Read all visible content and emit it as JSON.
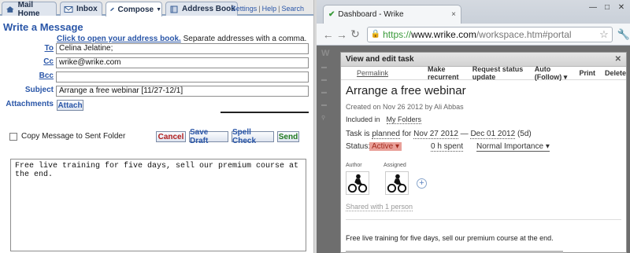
{
  "mail": {
    "tabs": [
      {
        "label": "Mail Home",
        "icon": "house-icon"
      },
      {
        "label": "Inbox",
        "icon": "envelope-icon"
      },
      {
        "label": "Compose",
        "icon": "pen-icon"
      },
      {
        "label": "Address Book",
        "icon": "book-icon"
      }
    ],
    "top_links": {
      "settings": "Settings",
      "help": "Help",
      "search": "Search"
    },
    "title": "Write a Message",
    "address_hint_link": "Click to open your address book.",
    "address_hint_text": " Separate addresses with a comma.",
    "fields": {
      "to_label": "To",
      "to_value": "Celina Jelatine;",
      "cc_label": "Cc",
      "cc_value": "wrike@wrike.com",
      "bcc_label": "Bcc",
      "bcc_value": "",
      "subject_label": "Subject",
      "subject_value": "Arrange a free webinar [11/27-12/1]",
      "attachments_label": "Attachments"
    },
    "attach_button": "Attach",
    "copy_label": "Copy Message to Sent Folder",
    "buttons": {
      "cancel": "Cancel",
      "save_draft": "Save Draft",
      "spell_check": "Spell Check",
      "send": "Send"
    },
    "body": "Free live training for five days, sell our premium course at the end."
  },
  "browser": {
    "tab_title": "Dashboard - Wrike",
    "url_scheme": "https://",
    "url_host": "www.wrike.com",
    "url_path": "/workspace.htm#portal",
    "modal": {
      "title": "View and edit task",
      "toolbar": {
        "permalink": "Permalink",
        "make_recurrent": "Make recurrent",
        "request_status": "Request status update",
        "auto_follow": "Auto (Follow)",
        "print": "Print",
        "delete": "Delete"
      },
      "task_title": "Arrange a free webinar",
      "created": "Created on Nov 26 2012 by Ali Abbas",
      "included_label": "Included in",
      "included_value": "My Folders",
      "planned_prefix": "Task is",
      "planned_word": "planned",
      "planned_for": "for",
      "start_date": "Nov 27 2012",
      "end_date": "Dec 01 2012",
      "duration": "(5d)",
      "status_label": "Status:",
      "status_value": "Active",
      "spent": "0 h spent",
      "importance": "Normal Importance",
      "author_label": "Author",
      "assigned_label": "Assigned",
      "shared": "Shared with 1 person",
      "description": "Free live training for five days, sell our premium course at the end."
    }
  }
}
